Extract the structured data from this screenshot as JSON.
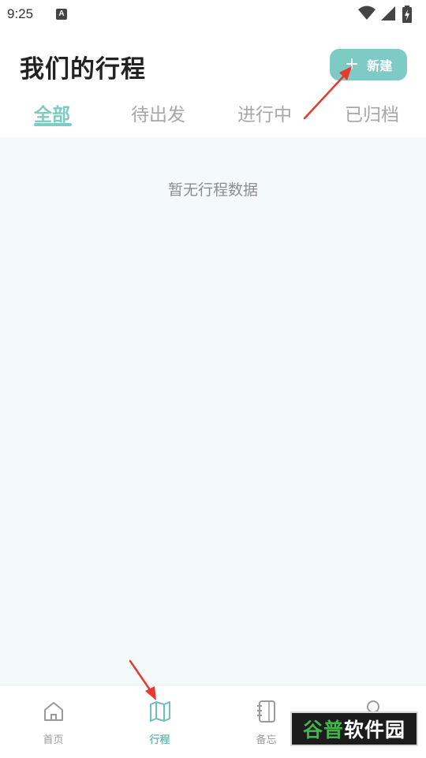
{
  "status_bar": {
    "time": "9:25",
    "notification_icon": "A"
  },
  "header": {
    "title": "我们的行程",
    "new_button_label": "新建"
  },
  "tabs": [
    {
      "label": "全部",
      "active": true
    },
    {
      "label": "待出发",
      "active": false
    },
    {
      "label": "进行中",
      "active": false
    },
    {
      "label": "已归档",
      "active": false
    }
  ],
  "content": {
    "empty_message": "暂无行程数据"
  },
  "bottom_nav": [
    {
      "label": "首页",
      "icon": "home-icon",
      "active": false
    },
    {
      "label": "行程",
      "icon": "map-icon",
      "active": true
    },
    {
      "label": "备忘",
      "icon": "notebook-icon",
      "active": false
    },
    {
      "label": "",
      "icon": "user-icon",
      "active": false
    }
  ],
  "watermark": {
    "part1": "谷普",
    "part2": "软件园"
  },
  "colors": {
    "accent": "#7ecac4",
    "content_bg": "#f4f9f9",
    "arrow": "#e8392f"
  }
}
